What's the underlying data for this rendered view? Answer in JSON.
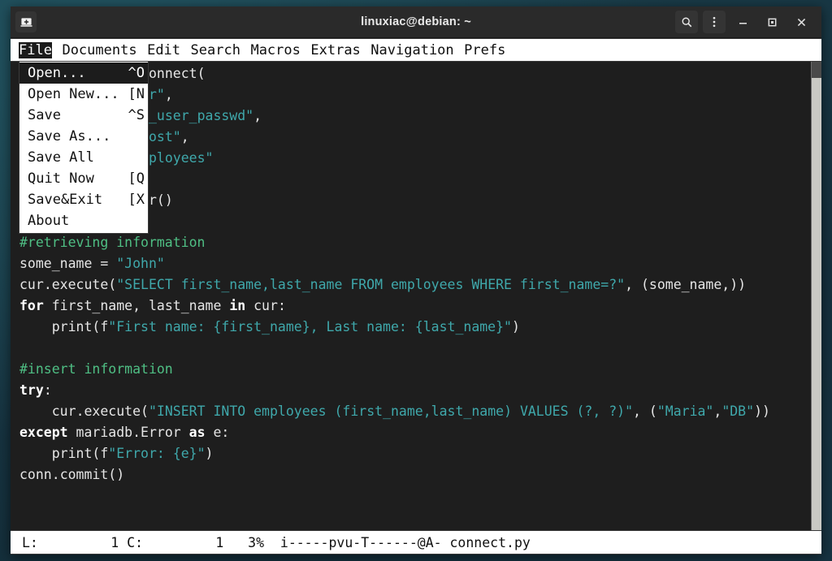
{
  "window": {
    "title": "linuxiac@debian: ~",
    "titlebar_icons": {
      "app_icon": "terminal-icon",
      "search": "search-icon",
      "menu": "vertical-dots-icon",
      "minimize": "minimize-icon",
      "maximize": "maximize-icon",
      "close": "close-icon"
    }
  },
  "menubar": {
    "items": [
      {
        "label": "File",
        "active": true
      },
      {
        "label": "Documents",
        "active": false
      },
      {
        "label": "Edit",
        "active": false
      },
      {
        "label": "Search",
        "active": false
      },
      {
        "label": "Macros",
        "active": false
      },
      {
        "label": "Extras",
        "active": false
      },
      {
        "label": "Navigation",
        "active": false
      },
      {
        "label": "Prefs",
        "active": false
      }
    ]
  },
  "dropdown": {
    "owner": "File",
    "items": [
      {
        "label": "Open...",
        "shortcut": "^O",
        "selected": true
      },
      {
        "label": "Open New...",
        "shortcut": "[N",
        "selected": false
      },
      {
        "label": "Save",
        "shortcut": "^S",
        "selected": false
      },
      {
        "label": "Save As...",
        "shortcut": "",
        "selected": false
      },
      {
        "label": "Save All",
        "shortcut": "",
        "selected": false
      },
      {
        "label": "Quit Now",
        "shortcut": "[Q",
        "selected": false
      },
      {
        "label": "Save&Exit",
        "shortcut": "[X",
        "selected": false
      },
      {
        "label": "About",
        "shortcut": "",
        "selected": false
      }
    ]
  },
  "editor": {
    "filename": "connect.py",
    "language": "python",
    "colors": {
      "background": "#1e1e1e",
      "foreground": "#e6e6e6",
      "comment": "#4fbf84",
      "string": "#3fa8ab",
      "keyword": "#ffffff"
    },
    "lines": [
      "conn = mariadb.connect(",
      "    user=\"db_user\",",
      "    password=\"db_user_passwd\",",
      "    host=\"localhost\",",
      "    database=\"employees\"",
      ")",
      "cur = conn.cursor()",
      "",
      "#retrieving information",
      "some_name = \"John\"",
      "cur.execute(\"SELECT first_name,last_name FROM employees WHERE first_name=?\", (some_name,))",
      "for first_name, last_name in cur:",
      "    print(f\"First name: {first_name}, Last name: {last_name}\")",
      "",
      "#insert information",
      "try:",
      "    cur.execute(\"INSERT INTO employees (first_name,last_name) VALUES (?, ?)\", (\"Maria\",\"DB\"))",
      "except mariadb.Error as e:",
      "    print(f\"Error: {e}\")",
      "conn.commit()"
    ]
  },
  "statusbar": {
    "line_label": "L:",
    "line_value": "1",
    "col_label": "C:",
    "col_value": "1",
    "percent": "3%",
    "flags": "i-----pvu-T------@A-",
    "filename": "connect.py",
    "text": "L:         1 C:         1   3%  i-----pvu-T------@A- connect.py"
  }
}
